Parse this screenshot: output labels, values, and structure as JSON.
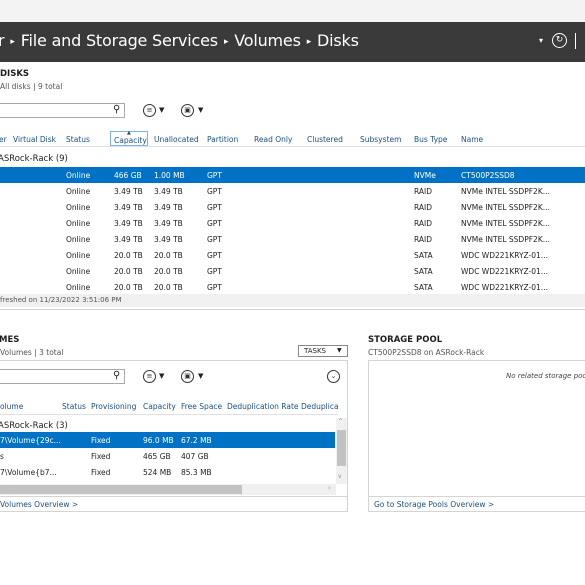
{
  "breadcrumb": {
    "items": [
      "r",
      "File and Storage Services",
      "Volumes",
      "Disks"
    ]
  },
  "disks": {
    "title": "DISKS",
    "subtitle": "All disks | 9 total",
    "columns": [
      "er",
      "Virtual Disk",
      "Status",
      "Capacity",
      "Unallocated",
      "Partition",
      "Read Only",
      "Clustered",
      "Subsystem",
      "Bus Type",
      "Name"
    ],
    "group": "ASRock-Rack (9)",
    "rows": [
      {
        "status": "Online",
        "capacity": "466 GB",
        "unallocated": "1.00 MB",
        "partition": "GPT",
        "bus": "NVMe",
        "name": "CT500P2SSD8"
      },
      {
        "status": "Online",
        "capacity": "3.49 TB",
        "unallocated": "3.49 TB",
        "partition": "GPT",
        "bus": "RAID",
        "name": "NVMe INTEL SSDPF2K..."
      },
      {
        "status": "Online",
        "capacity": "3.49 TB",
        "unallocated": "3.49 TB",
        "partition": "GPT",
        "bus": "RAID",
        "name": "NVMe INTEL SSDPF2K..."
      },
      {
        "status": "Online",
        "capacity": "3.49 TB",
        "unallocated": "3.49 TB",
        "partition": "GPT",
        "bus": "RAID",
        "name": "NVMe INTEL SSDPF2K..."
      },
      {
        "status": "Online",
        "capacity": "3.49 TB",
        "unallocated": "3.49 TB",
        "partition": "GPT",
        "bus": "RAID",
        "name": "NVMe INTEL SSDPF2K..."
      },
      {
        "status": "Online",
        "capacity": "20.0 TB",
        "unallocated": "20.0 TB",
        "partition": "GPT",
        "bus": "SATA",
        "name": "WDC WD221KRYZ-01..."
      },
      {
        "status": "Online",
        "capacity": "20.0 TB",
        "unallocated": "20.0 TB",
        "partition": "GPT",
        "bus": "SATA",
        "name": "WDC WD221KRYZ-01..."
      },
      {
        "status": "Online",
        "capacity": "20.0 TB",
        "unallocated": "20.0 TB",
        "partition": "GPT",
        "bus": "SATA",
        "name": "WDC WD221KRYZ-01..."
      }
    ],
    "status_text": "freshed on 11/23/2022 3:51:06 PM"
  },
  "volumes": {
    "title": "MES",
    "subtitle": "Volumes | 3 total",
    "tasks_label": "TASKS",
    "columns": [
      "olume",
      "Status",
      "Provisioning",
      "Capacity",
      "Free Space",
      "Deduplication Rate",
      "Deduplica"
    ],
    "group": "ASRock-Rack (3)",
    "rows": [
      {
        "volume": "7\\Volume{29c...",
        "prov": "Fixed",
        "capacity": "96.0 MB",
        "free": "67.2 MB"
      },
      {
        "volume": "s",
        "prov": "Fixed",
        "capacity": "465 GB",
        "free": "407 GB"
      },
      {
        "volume": "7\\Volume{b7...",
        "prov": "Fixed",
        "capacity": "524 MB",
        "free": "85.3 MB"
      }
    ],
    "link": "Volumes Overview >"
  },
  "pool": {
    "title": "STORAGE POOL",
    "subtitle": "CT500P2SSD8 on ASRock-Rack",
    "empty": "No related storage poo",
    "link": "Go to Storage Pools Overview >"
  },
  "colors": {
    "accent": "#0072c6",
    "titlebar": "#3a3a3a",
    "link": "#1a4f8a"
  },
  "icons": {
    "search": "search-icon",
    "refresh": "refresh-icon",
    "filter": "list-filter-icon",
    "save": "save-query-icon",
    "expand": "chevron-down-icon"
  }
}
